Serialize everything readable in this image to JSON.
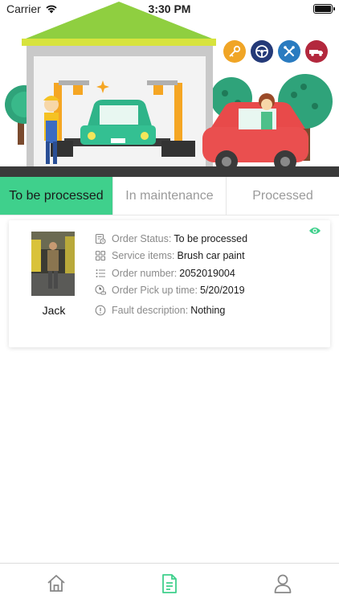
{
  "status_bar": {
    "carrier": "Carrier",
    "time": "3:30 PM"
  },
  "banner": {
    "service_icons": [
      {
        "name": "key-icon",
        "color": "#f0a526"
      },
      {
        "name": "steering-wheel-icon",
        "color": "#243a78"
      },
      {
        "name": "tools-icon",
        "color": "#2a7bc0"
      },
      {
        "name": "tow-truck-icon",
        "color": "#b3283d"
      }
    ]
  },
  "tabs": {
    "to_be_processed": "To be processed",
    "in_maintenance": "In maintenance",
    "processed": "Processed",
    "active_color": "#3fd08c"
  },
  "order": {
    "customer_name": "Jack",
    "status_label": "Order Status:",
    "status_value": "To be processed",
    "service_label": "Service items:",
    "service_value": "Brush car paint",
    "number_label": "Order number:",
    "number_value": "2052019004",
    "pickup_label": "Order Pick up time:",
    "pickup_value": "5/20/2019",
    "fault_label": "Fault description:",
    "fault_value": "Nothing"
  },
  "nav": {
    "items": [
      "home-icon",
      "orders-icon",
      "profile-icon"
    ],
    "active_color": "#3fd08c",
    "inactive_color": "#888888"
  }
}
